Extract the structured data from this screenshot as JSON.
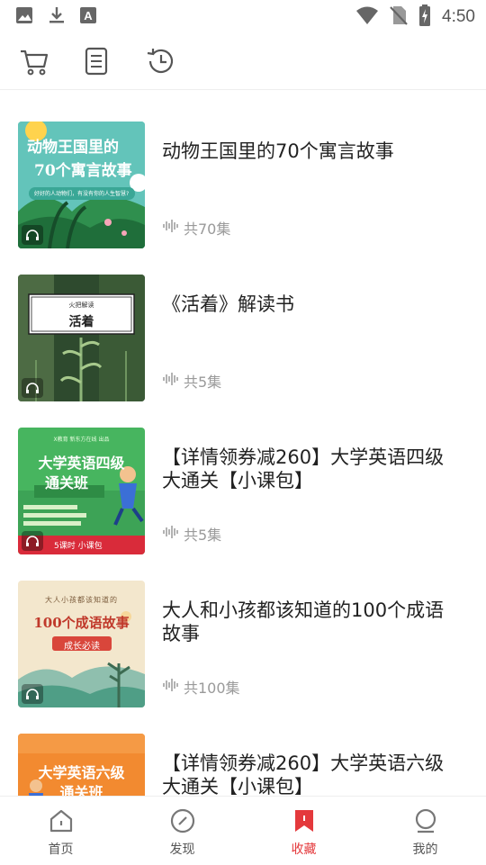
{
  "status_bar": {
    "time": "4:50",
    "left_icons": [
      "image-icon",
      "download-icon",
      "text-a-icon"
    ],
    "right_icons": [
      "wifi-icon",
      "no-sim-icon",
      "battery-charging-icon"
    ]
  },
  "toolbar": {
    "icons": [
      "cart-icon",
      "notes-icon",
      "history-icon"
    ]
  },
  "list": {
    "items": [
      {
        "title": "动物王国里的70个寓言故事",
        "meta": "共70集",
        "thumb_heading": "动物王国里的",
        "thumb_sub": "70个寓言故事",
        "thumb_banner": "好好的人动物们，有没有你的人生智慧?",
        "thumb_color": "#4bb9b0"
      },
      {
        "title": "《活着》解读书",
        "meta": "共5集",
        "thumb_small": "火把解读",
        "thumb_heading": "活着",
        "thumb_color": "#3d5a3a"
      },
      {
        "title": "【详情领券减260】大学英语四级大通关【小课包】",
        "meta": "共5集",
        "thumb_top": "X教育 新东方在线 出品",
        "thumb_heading": "大学英语四级",
        "thumb_sub": "通关班",
        "thumb_footer": "5课时 小课包",
        "thumb_color": "#3fb05a"
      },
      {
        "title": "大人和小孩都该知道的100个成语故事",
        "meta": "共100集",
        "thumb_top": "大人小孩都该知道的",
        "thumb_heading": "100个成语故事",
        "thumb_sub": "成长必读",
        "thumb_color": "#f2e6cc"
      },
      {
        "title": "【详情领券减260】大学英语六级大通关【小课包】",
        "meta": "",
        "thumb_heading": "大学英语六级",
        "thumb_sub": "通关班",
        "thumb_color": "#f08a2c"
      }
    ]
  },
  "bottom_nav": {
    "items": [
      {
        "label": "首页",
        "icon": "home-icon",
        "active": false
      },
      {
        "label": "发现",
        "icon": "compass-icon",
        "active": false
      },
      {
        "label": "收藏",
        "icon": "bookmark-icon",
        "active": true
      },
      {
        "label": "我的",
        "icon": "profile-icon",
        "active": false
      }
    ]
  },
  "colors": {
    "accent": "#e4393c",
    "text": "#222222",
    "muted": "#9a9a9a"
  }
}
